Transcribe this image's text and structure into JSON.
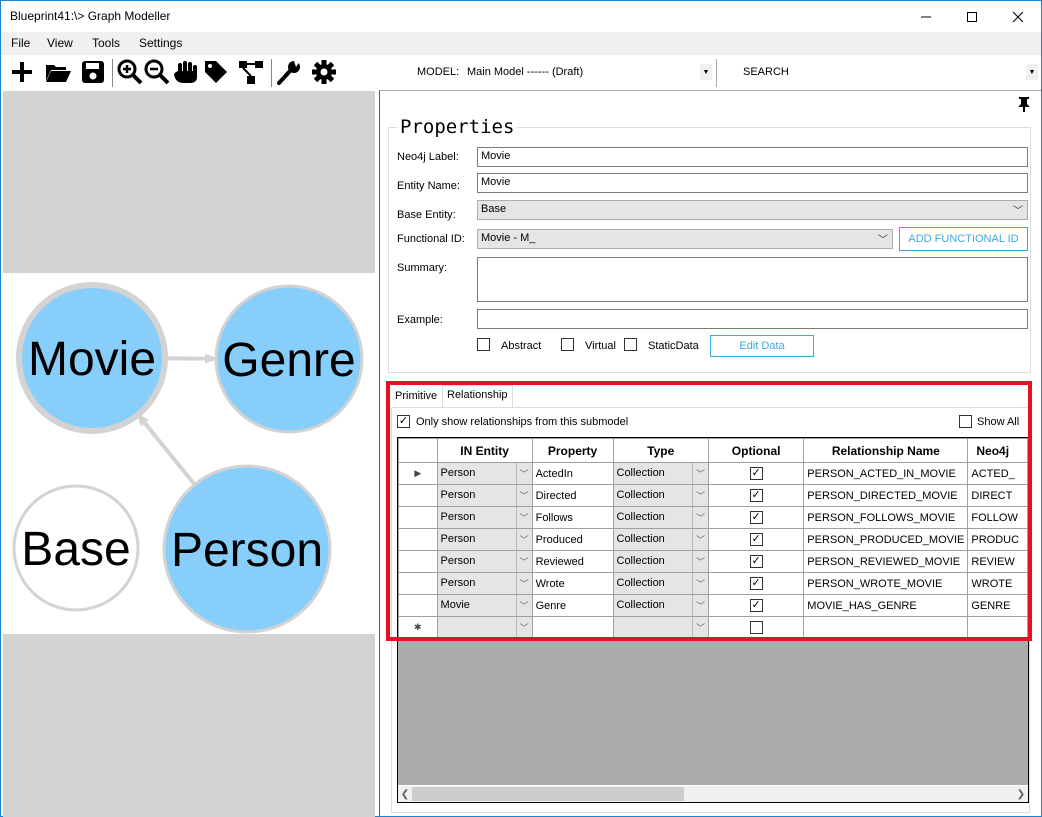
{
  "window": {
    "title": "Blueprint41:\\> Graph Modeller",
    "minimize_icon": "minimize-icon",
    "maximize_icon": "maximize-icon",
    "close_icon": "close-icon"
  },
  "menu": [
    "File",
    "View",
    "Tools",
    "Settings"
  ],
  "toolbar": {
    "icons": [
      "add-icon",
      "open-folder-icon",
      "save-icon",
      "zoom-in-icon",
      "zoom-out-icon",
      "hand-pan-icon",
      "tag-icon",
      "hierarchy-icon",
      "wrench-icon",
      "gear-icon"
    ],
    "model_label": "MODEL:",
    "model_value": "Main Model ------ (Draft)",
    "search_label": "SEARCH"
  },
  "graph": {
    "nodes": [
      {
        "label": "Movie",
        "fill": "#87cefa",
        "selected": true
      },
      {
        "label": "Genre",
        "fill": "#87cefa",
        "selected": false
      },
      {
        "label": "Base",
        "fill": "#ffffff",
        "selected": false
      },
      {
        "label": "Person",
        "fill": "#87cefa",
        "selected": false
      }
    ],
    "edges": [
      {
        "from": "Movie",
        "to": "Genre"
      },
      {
        "from": "Person",
        "to": "Movie"
      }
    ]
  },
  "properties": {
    "title": "Properties",
    "neo4j_label_label": "Neo4j Label:",
    "neo4j_label_value": "Movie",
    "entity_name_label": "Entity Name:",
    "entity_name_value": "Movie",
    "base_entity_label": "Base Entity:",
    "base_entity_value": "Base",
    "functional_id_label": "Functional ID:",
    "functional_id_value": "Movie - M_",
    "add_functional_id": "ADD FUNCTIONAL ID",
    "summary_label": "Summary:",
    "summary_value": "",
    "example_label": "Example:",
    "example_value": "",
    "abstract_label": "Abstract",
    "abstract_checked": false,
    "virtual_label": "Virtual",
    "virtual_checked": false,
    "staticdata_label": "StaticData",
    "staticdata_checked": false,
    "edit_data": "Edit Data"
  },
  "tabs": [
    {
      "label": "Primitive",
      "active": false
    },
    {
      "label": "Relationship",
      "active": true
    }
  ],
  "relationship": {
    "only_submodel_label": "Only show relationships from this submodel",
    "only_submodel_checked": true,
    "show_all_label": "Show All",
    "show_all_checked": false,
    "columns": [
      "IN Entity",
      "Property",
      "Type",
      "Optional",
      "Relationship Name",
      "Neo4j"
    ],
    "rows": [
      {
        "in_entity": "Person",
        "property": "ActedIn",
        "type": "Collection",
        "optional": true,
        "rel_name": "PERSON_ACTED_IN_MOVIE",
        "neo4j": "ACTED_",
        "current": true
      },
      {
        "in_entity": "Person",
        "property": "Directed",
        "type": "Collection",
        "optional": true,
        "rel_name": "PERSON_DIRECTED_MOVIE",
        "neo4j": "DIRECT"
      },
      {
        "in_entity": "Person",
        "property": "Follows",
        "type": "Collection",
        "optional": true,
        "rel_name": "PERSON_FOLLOWS_MOVIE",
        "neo4j": "FOLLOW"
      },
      {
        "in_entity": "Person",
        "property": "Produced",
        "type": "Collection",
        "optional": true,
        "rel_name": "PERSON_PRODUCED_MOVIE",
        "neo4j": "PRODUC"
      },
      {
        "in_entity": "Person",
        "property": "Reviewed",
        "type": "Collection",
        "optional": true,
        "rel_name": "PERSON_REVIEWED_MOVIE",
        "neo4j": "REVIEW"
      },
      {
        "in_entity": "Person",
        "property": "Wrote",
        "type": "Collection",
        "optional": true,
        "rel_name": "PERSON_WROTE_MOVIE",
        "neo4j": "WROTE"
      },
      {
        "in_entity": "Movie",
        "property": "Genre",
        "type": "Collection",
        "optional": true,
        "rel_name": "MOVIE_HAS_GENRE",
        "neo4j": "GENRE"
      },
      {
        "in_entity": "",
        "property": "",
        "type": "",
        "optional": false,
        "rel_name": "",
        "neo4j": "",
        "new_row": true
      }
    ]
  }
}
